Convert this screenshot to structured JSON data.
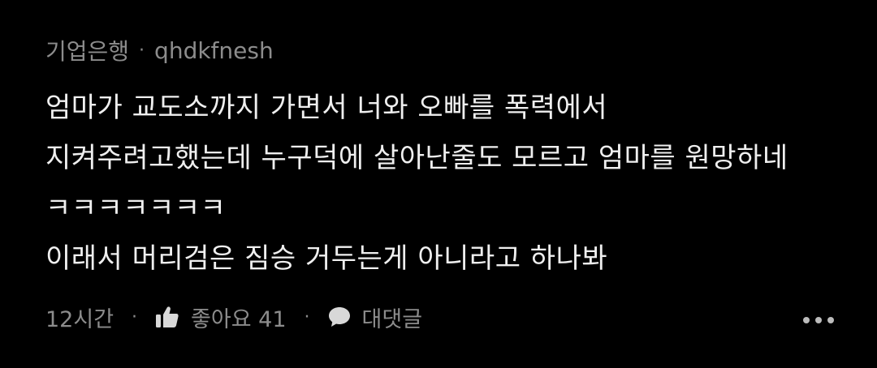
{
  "comment": {
    "author_tag": "기업은행",
    "username": "qhdkfnesh",
    "header_separator": "·",
    "lines": [
      "엄마가 교도소까지 가면서 너와 오빠를 폭력에서",
      "지켜주려고했는데 누구덕에 살아난줄도 모르고 엄마를 원망하네",
      "ㅋㅋㅋㅋㅋㅋㅋ",
      "이래서 머리검은 짐승 거두는게 아니라고 하나봐"
    ],
    "time": "12시간",
    "like_label": "좋아요 41",
    "reply_label": "대댓글",
    "footer_separator": "·",
    "icons": {
      "like": "thumbs-up-icon",
      "reply": "speech-bubble-icon",
      "more": "more-dots-icon"
    },
    "colors": {
      "background": "#000000",
      "text": "#efefef",
      "muted": "#8c8c8c"
    }
  }
}
